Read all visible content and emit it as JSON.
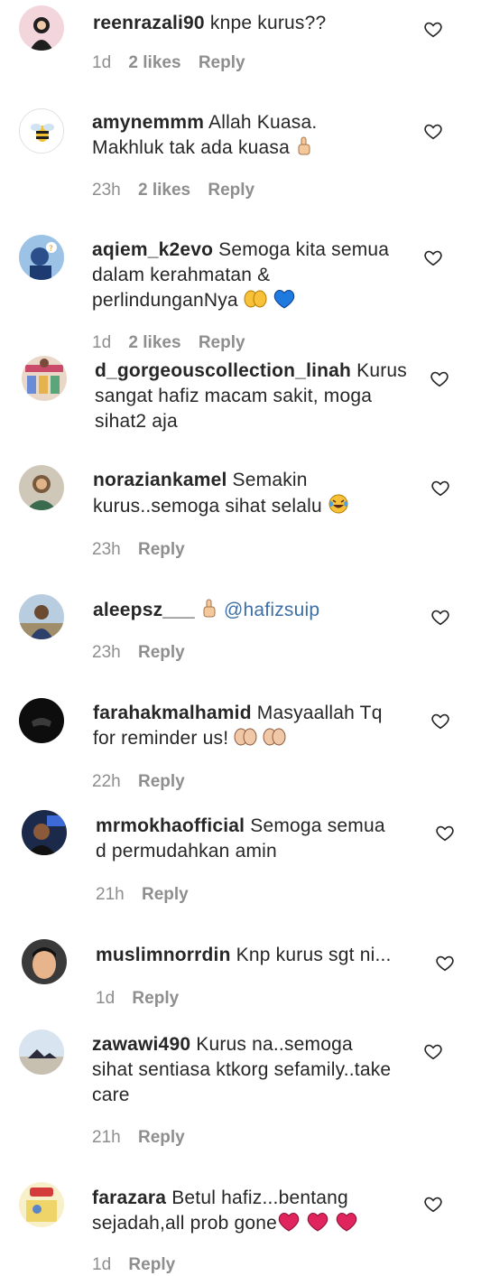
{
  "comments": [
    {
      "username": "reenrazali90",
      "text": "knpe kurus??",
      "time": "1d",
      "likes": "2 likes",
      "reply": "Reply",
      "avatar": "avatar-hijab"
    },
    {
      "username": "amynemmm",
      "text": "Allah Kuasa. Makhluk tak ada kuasa",
      "emoji": "☝️",
      "time": "23h",
      "likes": "2 likes",
      "reply": "Reply",
      "avatar": "avatar-bee"
    },
    {
      "username": "aqiem_k2evo",
      "text": "Semoga kita semua dalam kerahmatan & perlindunganNya",
      "emoji": "🤲 💙",
      "time": "1d",
      "likes": "2 likes",
      "reply": "Reply",
      "avatar": "avatar-blue"
    },
    {
      "username": "d_gorgeouscollection_linah",
      "text": "Kurus sangat hafiz macam sakit, moga sihat2 aja",
      "avatar": "avatar-shop"
    },
    {
      "username": "norazian kamel",
      "text": "Semakin kurus..semoga sihat selalu",
      "emoji": "😂",
      "time": "23h",
      "reply": "Reply",
      "avatar": "avatar-person"
    },
    {
      "username": "aleepsz___",
      "emoji": "☝️",
      "mention": "@hafizsuip",
      "time": "23h",
      "reply": "Reply",
      "avatar": "avatar-outdoor"
    },
    {
      "username": "farahakmalhamid",
      "text": "Masyaallah Tq for reminder us!",
      "emoji": "🤲 🤲",
      "time": "22h",
      "reply": "Reply",
      "avatar": "avatar-black"
    },
    {
      "username": "mrmokhaofficial",
      "text": "Semoga semua d permudahkan amin",
      "time": "21h",
      "reply": "Reply",
      "avatar": "avatar-stage"
    },
    {
      "username": "muslimnorrdin",
      "text": "Knp kurus sgt ni...",
      "time": "1d",
      "reply": "Reply",
      "avatar": "avatar-face"
    },
    {
      "username": "zawawi490",
      "text": "Kurus na..semoga sihat sentiasa ktkorg sefamily..take care",
      "time": "21h",
      "reply": "Reply",
      "avatar": "avatar-sky"
    },
    {
      "username": "farazara",
      "text": "Betul hafiz...bentang sejadah,all prob gone",
      "emoji": "❤️ ❤️ ❤️",
      "time": "1d",
      "reply": "Reply",
      "avatar": "avatar-logo"
    }
  ],
  "display": {
    "c0_user": "reenrazali90",
    "c0_text": "knpe kurus??",
    "c1_user": "amynemmm",
    "c1_l1": "Allah Kuasa.",
    "c1_l2": "Makhluk tak ada kuasa",
    "c2_user": "aqiem_k2evo",
    "c2_l1": "Semoga kita semua",
    "c2_l2": "dalam kerahmatan &",
    "c2_l3": "perlindunganNya",
    "c3_user": "d_gorgeouscollection_linah",
    "c3_l1": "Kurus",
    "c3_l2": "sangat hafiz macam sakit, moga",
    "c3_l3": "sihat2 aja",
    "c4_user": "noraziankamel",
    "c4_l1": "Semakin",
    "c4_l2": "kurus..semoga sihat selalu",
    "c5_user": "aleepsz___",
    "c5_mention": "@hafizsuip",
    "c6_user": "farahakmalhamid",
    "c6_l1": "Masyaallah Tq",
    "c6_l2": "for reminder us!",
    "c7_user": "mrmokhaofficial",
    "c7_l1": "Semoga semua",
    "c7_l2": "d permudahkan amin",
    "c8_user": "muslimnorrdin",
    "c8_l1": "Knp kurus sgt ni...",
    "c9_user": "zawawi490",
    "c9_l1": "Kurus na..semoga",
    "c9_l2": "sihat sentiasa ktkorg sefamily..take",
    "c9_l3": "care",
    "c10_user": "farazara",
    "c10_l1": "Betul hafiz...bentang",
    "c10_l2": "sejadah,all prob gone"
  },
  "meta": {
    "t1d": "1d",
    "t23h": "23h",
    "t22h": "22h",
    "t21h": "21h",
    "likes2": "2 likes",
    "reply": "Reply"
  },
  "colors": {
    "text": "#262626",
    "muted": "#8e8e8e",
    "mention": "#3d6fa6",
    "heart_emoji": "#e0245e",
    "blue_heart": "#1f7ae0"
  }
}
